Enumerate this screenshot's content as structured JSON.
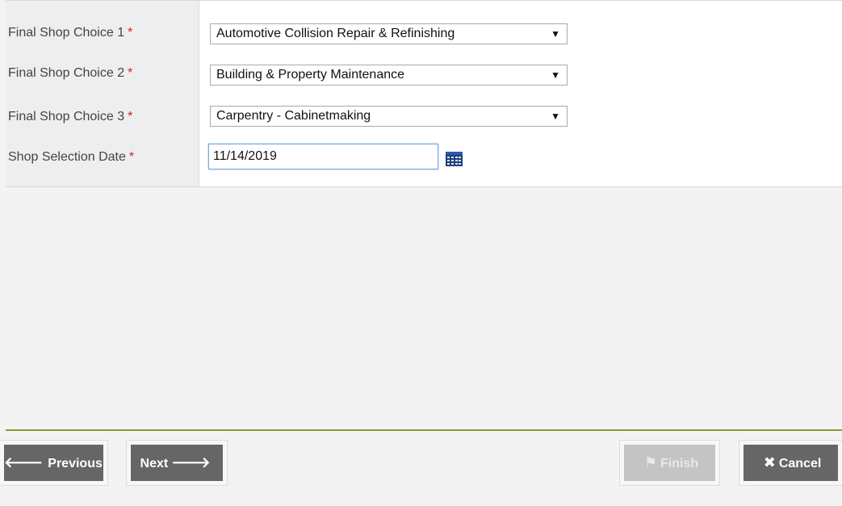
{
  "form": {
    "fields": [
      {
        "label": "Final Shop Choice 1",
        "required_marker": "*",
        "value": "Automotive Collision Repair & Refinishing"
      },
      {
        "label": "Final Shop Choice 2",
        "required_marker": "*",
        "value": "Building & Property Maintenance"
      },
      {
        "label": "Final Shop Choice 3",
        "required_marker": "*",
        "value": "Carpentry - Cabinetmaking"
      }
    ],
    "date": {
      "label": "Shop Selection Date",
      "required_marker": "*",
      "value": "11/14/2019"
    },
    "dropdown_arrow": "▼"
  },
  "buttons": {
    "previous": {
      "label": "Previous",
      "icon": "arrow-left-icon",
      "glyph": "🡐"
    },
    "next": {
      "label": "Next",
      "icon": "arrow-right-icon",
      "glyph": "🡒"
    },
    "finish": {
      "label": "Finish",
      "icon": "flag-icon",
      "glyph": "⚑"
    },
    "cancel": {
      "label": "Cancel",
      "icon": "close-icon",
      "glyph": "✖"
    }
  },
  "colors": {
    "required": "#cc2222",
    "button_bg": "#666666",
    "button_disabled_bg": "#c4c4c4",
    "divider": "#8a9a3a",
    "focus_border": "#7aa7d8"
  }
}
